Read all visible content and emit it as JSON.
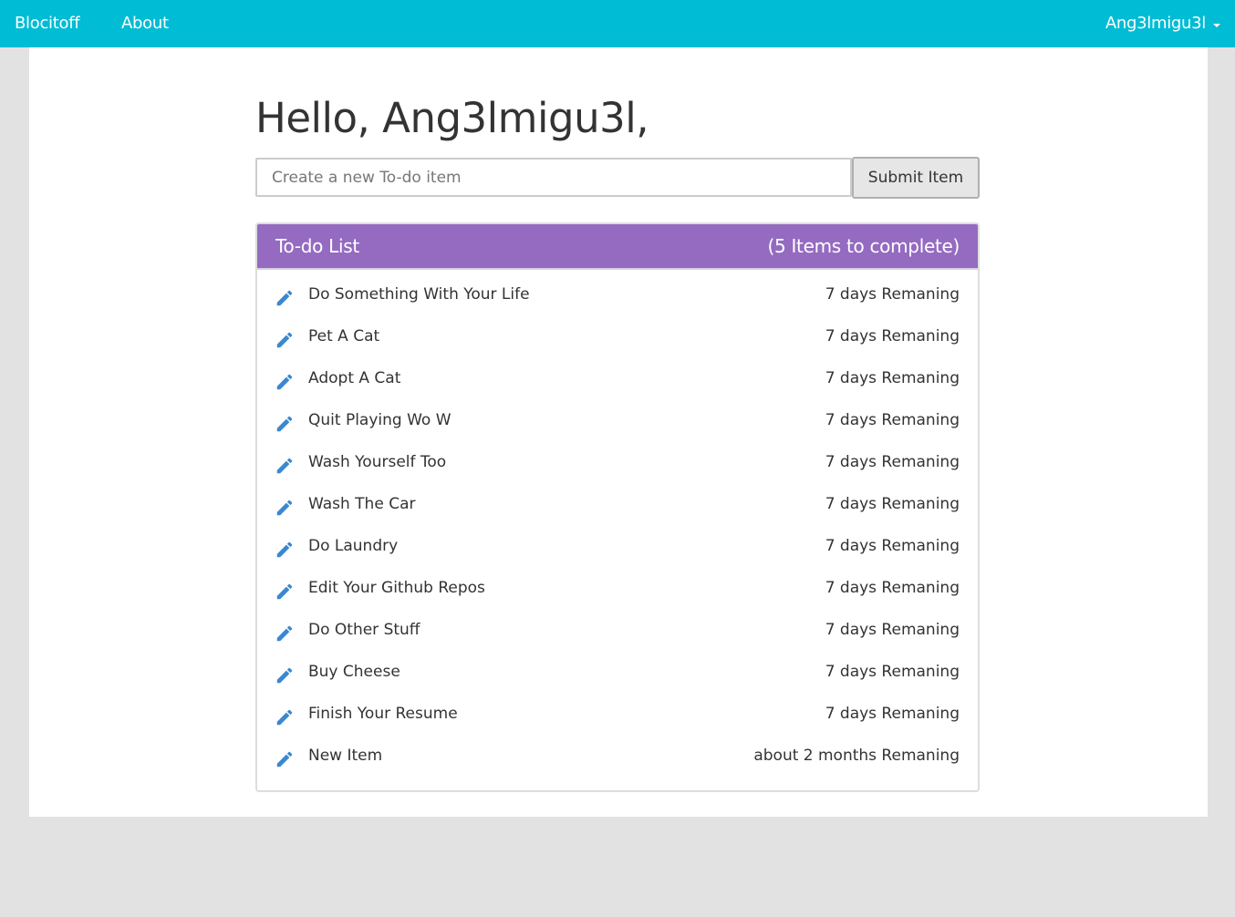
{
  "navbar": {
    "brand": "Blocitoff",
    "about": "About",
    "user": "Ang3lmigu3l",
    "background_color": "#00bcd4",
    "user_menu_icon": "caret-down-icon"
  },
  "main": {
    "greeting": "Hello, Ang3lmigu3l,",
    "new_item": {
      "placeholder": "Create a new To-do item",
      "value": "",
      "submit_label": "Submit Item"
    },
    "todo_panel": {
      "title": "To-do List",
      "count_text": "(5 Items to complete)",
      "header_color": "#946bc0",
      "item_icon": "pencil-icon",
      "icon_color": "#3b87d0",
      "items": [
        {
          "name": "Do Something With Your Life",
          "remaining": "7 days Remaning"
        },
        {
          "name": "Pet A Cat",
          "remaining": "7 days Remaning"
        },
        {
          "name": "Adopt A Cat",
          "remaining": "7 days Remaning"
        },
        {
          "name": "Quit Playing Wo W",
          "remaining": "7 days Remaning"
        },
        {
          "name": "Wash Yourself Too",
          "remaining": "7 days Remaning"
        },
        {
          "name": "Wash The Car",
          "remaining": "7 days Remaning"
        },
        {
          "name": "Do Laundry",
          "remaining": "7 days Remaning"
        },
        {
          "name": "Edit Your Github Repos",
          "remaining": "7 days Remaning"
        },
        {
          "name": "Do Other Stuff",
          "remaining": "7 days Remaning"
        },
        {
          "name": "Buy Cheese",
          "remaining": "7 days Remaning"
        },
        {
          "name": "Finish Your Resume",
          "remaining": "7 days Remaning"
        },
        {
          "name": "New Item",
          "remaining": "about 2 months Remaning"
        }
      ]
    }
  }
}
